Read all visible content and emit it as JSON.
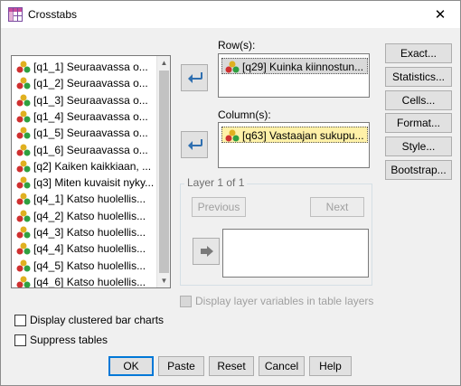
{
  "window": {
    "title": "Crosstabs",
    "close_glyph": "✕"
  },
  "variables": [
    "[q1_1] Seuraavassa o...",
    "[q1_2] Seuraavassa o...",
    "[q1_3] Seuraavassa o...",
    "[q1_4] Seuraavassa o...",
    "[q1_5] Seuraavassa o...",
    "[q1_6] Seuraavassa o...",
    "[q2] Kaiken kaikkiaan, ...",
    "[q3] Miten kuvaisit nyky...",
    "[q4_1] Katso huolellis...",
    "[q4_2] Katso huolellis...",
    "[q4_3] Katso huolellis...",
    "[q4_4] Katso huolellis...",
    "[q4_5] Katso huolellis...",
    "[q4_6] Katso huolellis..."
  ],
  "rows": {
    "label": "Row(s):",
    "value": "[q29] Kuinka kiinnostun..."
  },
  "columns": {
    "label": "Column(s):",
    "value": "[q63] Vastaajan sukupu..."
  },
  "layer": {
    "title": "Layer 1 of 1",
    "previous_label": "Previous",
    "next_label": "Next"
  },
  "side_buttons": {
    "exact": "Exact...",
    "statistics": "Statistics...",
    "cells": "Cells...",
    "format": "Format...",
    "style": "Style...",
    "bootstrap": "Bootstrap..."
  },
  "options": {
    "display_layer": "Display layer variables in table layers",
    "clustered_bar": "Display clustered bar charts",
    "suppress_tables": "Suppress tables"
  },
  "bottom_buttons": {
    "ok": "OK",
    "paste": "Paste",
    "reset": "Reset",
    "cancel": "Cancel",
    "help": "Help"
  },
  "icons": {
    "variable": "nominal-variable-icon",
    "move": "arrow-right-icon"
  },
  "colors": {
    "column_selection": "#fff1a8",
    "row_selection": "#d9d9d9",
    "focus_border": "#0078d7"
  }
}
